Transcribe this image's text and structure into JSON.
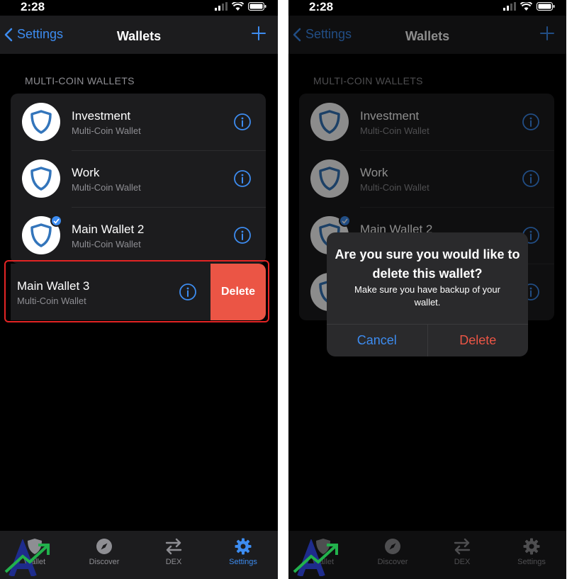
{
  "colors": {
    "accent": "#3d8cf0",
    "destructive": "#eb5545",
    "background": "#000000",
    "surface": "#1c1c1e",
    "highlight": "#e32424"
  },
  "status_bar": {
    "time": "2:28"
  },
  "nav": {
    "back_label": "Settings",
    "title": "Wallets",
    "add_icon": "plus-icon"
  },
  "section_header": "MULTI-COIN WALLETS",
  "wallets": [
    {
      "name": "Investment",
      "type": "Multi-Coin Wallet",
      "selected": false
    },
    {
      "name": "Work",
      "type": "Multi-Coin Wallet",
      "selected": false
    },
    {
      "name": "Main Wallet 2",
      "type": "Multi-Coin Wallet",
      "selected": true
    },
    {
      "name": "Main Wallet 3",
      "type": "Multi-Coin Wallet",
      "selected": false
    }
  ],
  "swipe_action": {
    "label": "Delete"
  },
  "alert": {
    "title": "Are you sure you would like to delete this wallet?",
    "message": "Make sure you have backup of your wallet.",
    "cancel_label": "Cancel",
    "delete_label": "Delete"
  },
  "tabs": [
    {
      "label": "Wallet",
      "icon": "shield-icon",
      "active": false
    },
    {
      "label": "Discover",
      "icon": "compass-icon",
      "active": false
    },
    {
      "label": "DEX",
      "icon": "swap-arrows-icon",
      "active": false
    },
    {
      "label": "Settings",
      "icon": "gear-icon",
      "active": true
    }
  ]
}
